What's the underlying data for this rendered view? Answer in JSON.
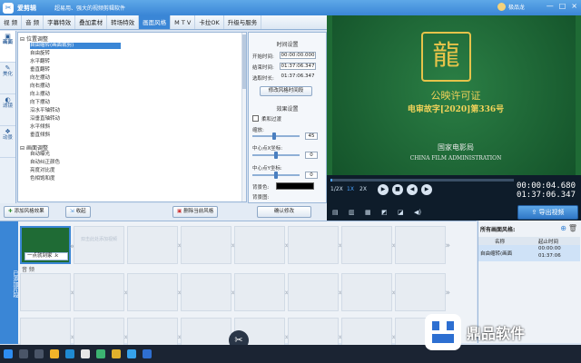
{
  "app": {
    "name": "爱剪辑",
    "slogan": "超易用、强大的视频剪辑软件",
    "user": "极品龙",
    "window_buttons": [
      "—",
      "□",
      "×"
    ]
  },
  "tabs": [
    "视 频",
    "音 频",
    "字幕特效",
    "叠加素材",
    "转场特效",
    "画面风格",
    "M T V",
    "卡拉OK",
    "升级与服务"
  ],
  "sidebar": [
    "画面",
    "美化",
    "滤镜",
    "动景"
  ],
  "effects": {
    "group1": "位置调整",
    "group1_items": [
      "自由缩转(画面裁剪)",
      "自由旋转",
      "水平翻转",
      "垂直翻转",
      "向左摆动",
      "向右摆动",
      "向上摆动",
      "向下摆动",
      "沿水平轴转动",
      "沿垂直轴转动",
      "水平倾斜",
      "垂直倾斜"
    ],
    "group2": "画面调整",
    "group2_items": [
      "自动曝光",
      "自动纠正颜色",
      "亮度对比度",
      "色相饱和度"
    ]
  },
  "settings": {
    "time_title": "时间设置",
    "start_label": "开始时间:",
    "start_value": "00:00:00.000",
    "end_label": "结束时间:",
    "end_value": "01:37:06.347",
    "duration_label": "选取时长:",
    "duration_value": "01:37:06.347",
    "modify_time_btn": "修改风格时间段",
    "effect_title": "效果设置",
    "smooth_label": "柔和过渡",
    "scale_label": "缩放:",
    "scale_value": "45",
    "cx_label": "中心点X坐标:",
    "cx_value": "0",
    "cy_label": "中心点Y坐标:",
    "cy_value": "0",
    "bgcolor_label": "背景色:",
    "bgimage_label": "背景图:",
    "confirm_btn": "确认修改"
  },
  "actions": {
    "add_effect": "添加风格效果",
    "collapse": "收起",
    "delete_effect": "删除当前风格"
  },
  "preview": {
    "line1": "公映许可证",
    "line2": "电审故字[2020]第336号",
    "line3": "国家电影局",
    "line4": "CHINA FILM ADMINISTRATION"
  },
  "player": {
    "speeds": [
      "1/2X",
      "1X",
      "2X"
    ],
    "current_time": "00:00:04.680",
    "total_time": "01:37:06.347"
  },
  "export": "导出视频",
  "timeline": {
    "side_label": "已添加片段",
    "audio_label": "音 频",
    "clip_label": "一点就到家 .k",
    "placeholder": "双击此处添加视频"
  },
  "style_list": {
    "title": "所有画面风格:",
    "col_name": "名称",
    "col_time": "起止时间",
    "row_name": "自由缩转(画面",
    "row_start": "00:00:00",
    "row_end": "01:37:06"
  },
  "watermark": "鼎品软件"
}
